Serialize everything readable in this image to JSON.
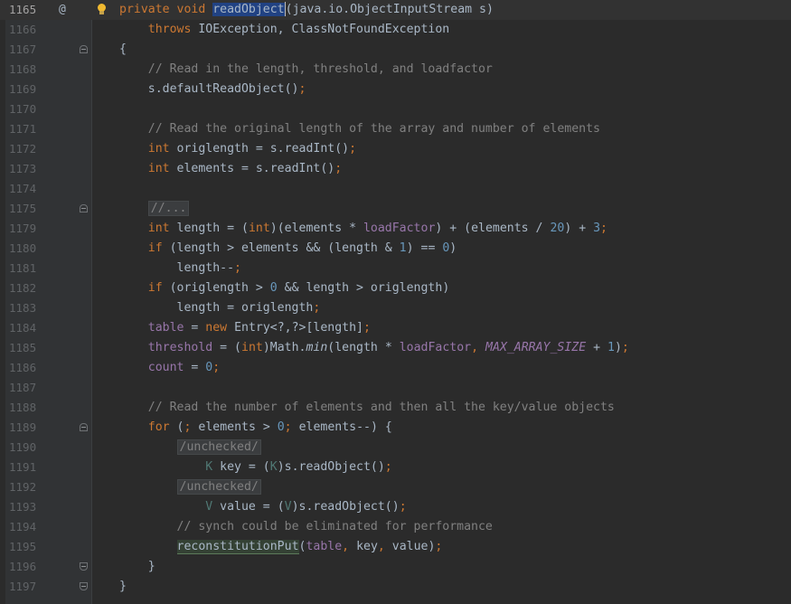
{
  "lines": [
    {
      "num": "1165",
      "parts": [
        [
          "kw",
          "private "
        ],
        [
          "kw",
          "void "
        ],
        [
          "sel",
          "readObject"
        ],
        [
          "caret",
          ""
        ],
        [
          "",
          "(java.io.ObjectInputStream s)"
        ]
      ]
    },
    {
      "num": "1166",
      "parts": [
        [
          "",
          "    "
        ],
        [
          "kw",
          "throws "
        ],
        [
          "",
          "IOException, ClassNotFoundException"
        ]
      ]
    },
    {
      "num": "1167",
      "parts": [
        [
          "",
          "{"
        ]
      ]
    },
    {
      "num": "1168",
      "parts": [
        [
          "",
          "    "
        ],
        [
          "cm",
          "// Read in the length, threshold, and loadfactor"
        ]
      ]
    },
    {
      "num": "1169",
      "parts": [
        [
          "",
          "    s.defaultReadObject()"
        ],
        [
          "kw",
          ";"
        ]
      ]
    },
    {
      "num": "1170",
      "parts": []
    },
    {
      "num": "1171",
      "parts": [
        [
          "",
          "    "
        ],
        [
          "cm",
          "// Read the original length of the array and number of elements"
        ]
      ]
    },
    {
      "num": "1172",
      "parts": [
        [
          "",
          "    "
        ],
        [
          "kw",
          "int "
        ],
        [
          "",
          "origlength = s.readInt()"
        ],
        [
          "kw",
          ";"
        ]
      ]
    },
    {
      "num": "1173",
      "parts": [
        [
          "",
          "    "
        ],
        [
          "kw",
          "int "
        ],
        [
          "",
          "elements = s.readInt()"
        ],
        [
          "kw",
          ";"
        ]
      ]
    },
    {
      "num": "1174",
      "parts": []
    },
    {
      "num": "1175",
      "parts": [
        [
          "",
          "    "
        ],
        [
          "folded",
          "//..."
        ]
      ]
    },
    {
      "num": "1179",
      "parts": [
        [
          "",
          "    "
        ],
        [
          "kw",
          "int "
        ],
        [
          "",
          "length = ("
        ],
        [
          "kw",
          "int"
        ],
        [
          "",
          ")(elements * "
        ],
        [
          "fld",
          "loadFactor"
        ],
        [
          "",
          ") + (elements / "
        ],
        [
          "num",
          "20"
        ],
        [
          "",
          ") + "
        ],
        [
          "num",
          "3"
        ],
        [
          "kw",
          ";"
        ]
      ]
    },
    {
      "num": "1180",
      "parts": [
        [
          "",
          "    "
        ],
        [
          "kw",
          "if "
        ],
        [
          "",
          "(length > elements && (length & "
        ],
        [
          "num",
          "1"
        ],
        [
          "",
          ") == "
        ],
        [
          "num",
          "0"
        ],
        [
          "",
          ")"
        ]
      ]
    },
    {
      "num": "1181",
      "parts": [
        [
          "",
          "        length--"
        ],
        [
          "kw",
          ";"
        ]
      ]
    },
    {
      "num": "1182",
      "parts": [
        [
          "",
          "    "
        ],
        [
          "kw",
          "if "
        ],
        [
          "",
          "(origlength > "
        ],
        [
          "num",
          "0"
        ],
        [
          "",
          ""
        ],
        [
          "",
          " && length > origlength)"
        ]
      ]
    },
    {
      "num": "1183",
      "parts": [
        [
          "",
          "        length = origlength"
        ],
        [
          "kw",
          ";"
        ]
      ]
    },
    {
      "num": "1184",
      "parts": [
        [
          "",
          "    "
        ],
        [
          "fld",
          "table "
        ],
        [
          "",
          "= "
        ],
        [
          "kw",
          "new "
        ],
        [
          "",
          "Entry<?,?>[length]"
        ],
        [
          "kw",
          ";"
        ]
      ]
    },
    {
      "num": "1185",
      "parts": [
        [
          "",
          "    "
        ],
        [
          "fld",
          "threshold "
        ],
        [
          "",
          "= ("
        ],
        [
          "kw",
          "int"
        ],
        [
          "",
          ")Math."
        ],
        [
          "ital",
          "min"
        ],
        [
          "",
          "(length * "
        ],
        [
          "fld",
          "loadFactor"
        ],
        [
          "kw",
          ", "
        ],
        [
          "cst",
          "MAX_ARRAY_SIZE "
        ],
        [
          "",
          "+ "
        ],
        [
          "num",
          "1"
        ],
        [
          "",
          ")"
        ],
        [
          "kw",
          ";"
        ]
      ]
    },
    {
      "num": "1186",
      "parts": [
        [
          "",
          "    "
        ],
        [
          "fld",
          "count "
        ],
        [
          "",
          "= "
        ],
        [
          "num",
          "0"
        ],
        [
          "kw",
          ";"
        ]
      ]
    },
    {
      "num": "1187",
      "parts": []
    },
    {
      "num": "1188",
      "parts": [
        [
          "",
          "    "
        ],
        [
          "cm",
          "// Read the number of elements and then all the key/value objects"
        ]
      ]
    },
    {
      "num": "1189",
      "parts": [
        [
          "",
          "    "
        ],
        [
          "kw",
          "for "
        ],
        [
          "",
          "("
        ],
        [
          "kw",
          "; "
        ],
        [
          "",
          "elements > "
        ],
        [
          "num",
          "0"
        ],
        [
          "kw",
          "; "
        ],
        [
          "",
          "elements--) {"
        ]
      ]
    },
    {
      "num": "1190",
      "parts": [
        [
          "",
          "        "
        ],
        [
          "folded",
          "/unchecked/"
        ]
      ]
    },
    {
      "num": "1191",
      "parts": [
        [
          "",
          "            "
        ],
        [
          "generic",
          "K "
        ],
        [
          "",
          "key = ("
        ],
        [
          "generic",
          "K"
        ],
        [
          "",
          ")s.readObject()"
        ],
        [
          "kw",
          ";"
        ]
      ]
    },
    {
      "num": "1192",
      "parts": [
        [
          "",
          "        "
        ],
        [
          "folded",
          "/unchecked/"
        ]
      ]
    },
    {
      "num": "1193",
      "parts": [
        [
          "",
          "            "
        ],
        [
          "generic",
          "V "
        ],
        [
          "",
          "value = ("
        ],
        [
          "generic",
          "V"
        ],
        [
          "",
          ")s.readObject()"
        ],
        [
          "kw",
          ";"
        ]
      ]
    },
    {
      "num": "1194",
      "parts": [
        [
          "",
          "        "
        ],
        [
          "cm",
          "// synch could be eliminated for performance"
        ]
      ]
    },
    {
      "num": "1195",
      "parts": [
        [
          "",
          "        "
        ],
        [
          "greenhl",
          "reconstitutionPut"
        ],
        [
          "",
          "("
        ],
        [
          "fld",
          "table"
        ],
        [
          "kw",
          ", "
        ],
        [
          "",
          "key"
        ],
        [
          "kw",
          ", "
        ],
        [
          "",
          "value)"
        ],
        [
          "kw",
          ";"
        ]
      ]
    },
    {
      "num": "1196",
      "parts": [
        [
          "",
          "    }"
        ]
      ]
    },
    {
      "num": "1197",
      "parts": [
        [
          "",
          "}"
        ]
      ]
    }
  ],
  "gutter_markers": {
    "at_line": "1165",
    "at_symbol": "@",
    "bulb_line": "1165",
    "fold_start_lines": [
      "1167",
      "1175",
      "1189"
    ],
    "fold_end_lines": [
      "1196",
      "1197"
    ]
  },
  "colors": {
    "background": "#2b2b2b",
    "gutter": "#313335",
    "keyword": "#cc7832",
    "comment": "#808080",
    "number": "#6897bb",
    "field": "#9876aa",
    "selection": "#214283"
  }
}
